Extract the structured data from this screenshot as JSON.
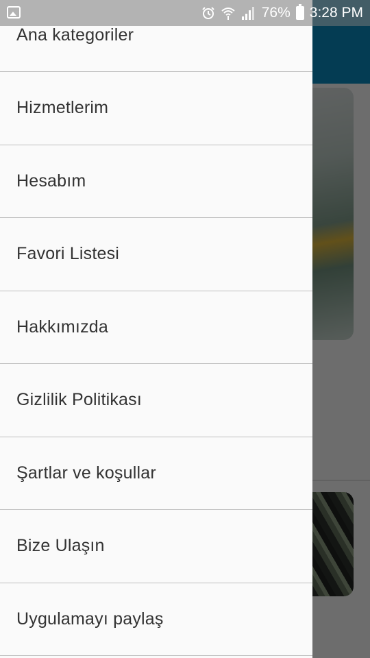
{
  "status_bar": {
    "battery": "76%",
    "time": "3:28 PM",
    "icons": [
      "image-notification-icon",
      "alarm-icon",
      "wifi-icon",
      "signal-icon",
      "battery-icon"
    ]
  },
  "drawer": {
    "items": [
      {
        "label": "Ana kategoriler"
      },
      {
        "label": "Hizmetlerim"
      },
      {
        "label": "Hesabım"
      },
      {
        "label": "Favori Listesi"
      },
      {
        "label": "Hakkımızda"
      },
      {
        "label": "Gizlilik Politikası"
      },
      {
        "label": "Şartlar ve koşullar"
      },
      {
        "label": "Bize Ulaşın"
      },
      {
        "label": "Uygulamayı paylaş"
      }
    ]
  },
  "colors": {
    "toolbar": "#0a86b8",
    "drawer_bg": "#fafafa",
    "text": "#333333",
    "divider": "#bdbdbd"
  }
}
